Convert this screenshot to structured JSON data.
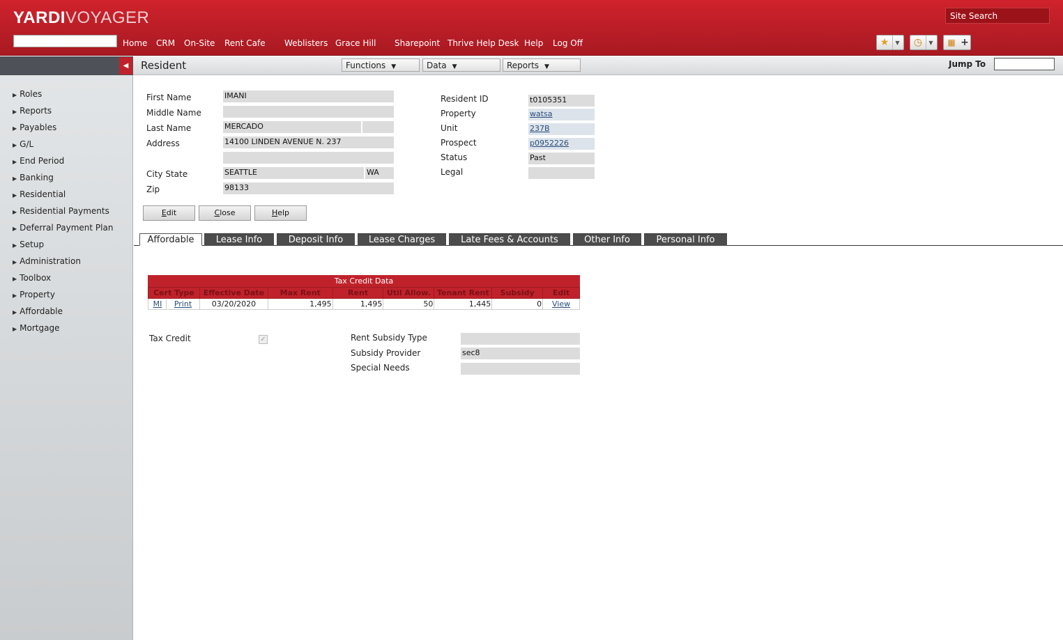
{
  "header": {
    "logo_bold": "YARDI",
    "logo_light": "VOYAGER",
    "site_search": "Site Search",
    "nav": [
      "Home",
      "CRM",
      "On-Site",
      "Rent Cafe",
      "Weblisters",
      "Grace Hill",
      "Sharepoint",
      "Thrive Help Desk",
      "Help",
      "Log Off"
    ]
  },
  "toolbar": {
    "title": "Resident",
    "functions": "Functions",
    "data": "Data",
    "reports": "Reports",
    "jump_to": "Jump To"
  },
  "sidebar": {
    "items": [
      "Roles",
      "Reports",
      "Payables",
      "G/L",
      "End Period",
      "Banking",
      "Residential",
      "Residential Payments",
      "Deferral Payment Plan",
      "Setup",
      "Administration",
      "Toolbox",
      "Property",
      "Affordable",
      "Mortgage"
    ]
  },
  "form": {
    "labels": {
      "first_name": "First Name",
      "middle_name": "Middle Name",
      "last_name": "Last Name",
      "address": "Address",
      "city_state": "City State",
      "zip": "Zip",
      "resident_id": "Resident ID",
      "property": "Property",
      "unit": "Unit",
      "prospect": "Prospect",
      "status": "Status",
      "legal": "Legal"
    },
    "values": {
      "first_name": "IMANI",
      "middle_name": "",
      "last_name": "MERCADO",
      "last_name_suffix": "",
      "address1": "14100 LINDEN AVENUE N. 237",
      "address2": "",
      "city": "SEATTLE",
      "state": "WA",
      "zip": "98133",
      "resident_id": "t0105351",
      "property": "watsa",
      "unit": "237B",
      "prospect": "p0952226",
      "status": "Past",
      "legal": ""
    },
    "buttons": {
      "edit": "Edit",
      "close": "Close",
      "help": "Help"
    }
  },
  "tabs": [
    "Affordable",
    "Lease Info",
    "Deposit Info",
    "Lease Charges",
    "Late Fees & Accounts",
    "Other Info",
    "Personal Info"
  ],
  "tax_credit": {
    "title": "Tax Credit Data",
    "headers": [
      "Cert Type",
      "Effective Date",
      "Max Rent",
      "Rent",
      "Util Allow.",
      "Tenant Rent",
      "Subsidy",
      "Edit"
    ],
    "row": {
      "cert_type": "MI",
      "print": "Print",
      "effective_date": "03/20/2020",
      "max_rent": "1,495",
      "rent": "1,495",
      "util_allow": "50",
      "tenant_rent": "1,445",
      "subsidy": "0",
      "edit": "View"
    }
  },
  "affordable": {
    "tax_credit_label": "Tax Credit",
    "tax_credit_checked": true,
    "rent_subsidy_type_label": "Rent Subsidy Type",
    "rent_subsidy_type": "",
    "subsidy_provider_label": "Subsidy Provider",
    "subsidy_provider": "sec8",
    "special_needs_label": "Special Needs",
    "special_needs": ""
  }
}
